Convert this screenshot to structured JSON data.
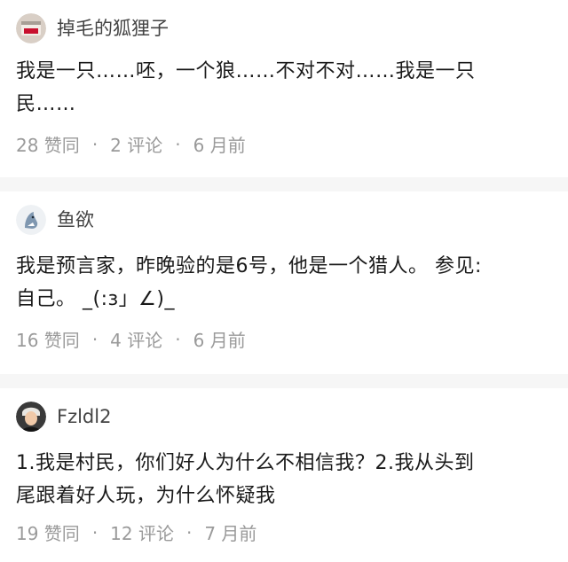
{
  "comments": [
    {
      "author": "掉毛的狐狸子",
      "text": "我是一只……呸，一个狼……不对不对……我是一只\n民……",
      "likes": "28 赞同",
      "replies": "2 评论",
      "time": "6 月前",
      "avatar_icon": "box-avatar-icon"
    },
    {
      "author": "鱼欲",
      "text": "我是预言家，昨晚验的是6号，他是一个猎人。 参见:\n自己。 _(:з」∠)_",
      "likes": "16 赞同",
      "replies": "4 评论",
      "time": "6 月前",
      "avatar_icon": "shark-avatar-icon"
    },
    {
      "author": "Fzldl2",
      "text": "1.我是村民，你们好人为什么不相信我？2.我从头到\n尾跟着好人玩，为什么怀疑我",
      "likes": "19 赞同",
      "replies": "12 评论",
      "time": "7 月前",
      "avatar_icon": "person-avatar-icon"
    }
  ],
  "meta_separator": "·",
  "colors": {
    "background": "#f6f6f6",
    "card": "#ffffff",
    "meta_text": "#9a9a9a",
    "body_text": "#1a1a1a"
  }
}
